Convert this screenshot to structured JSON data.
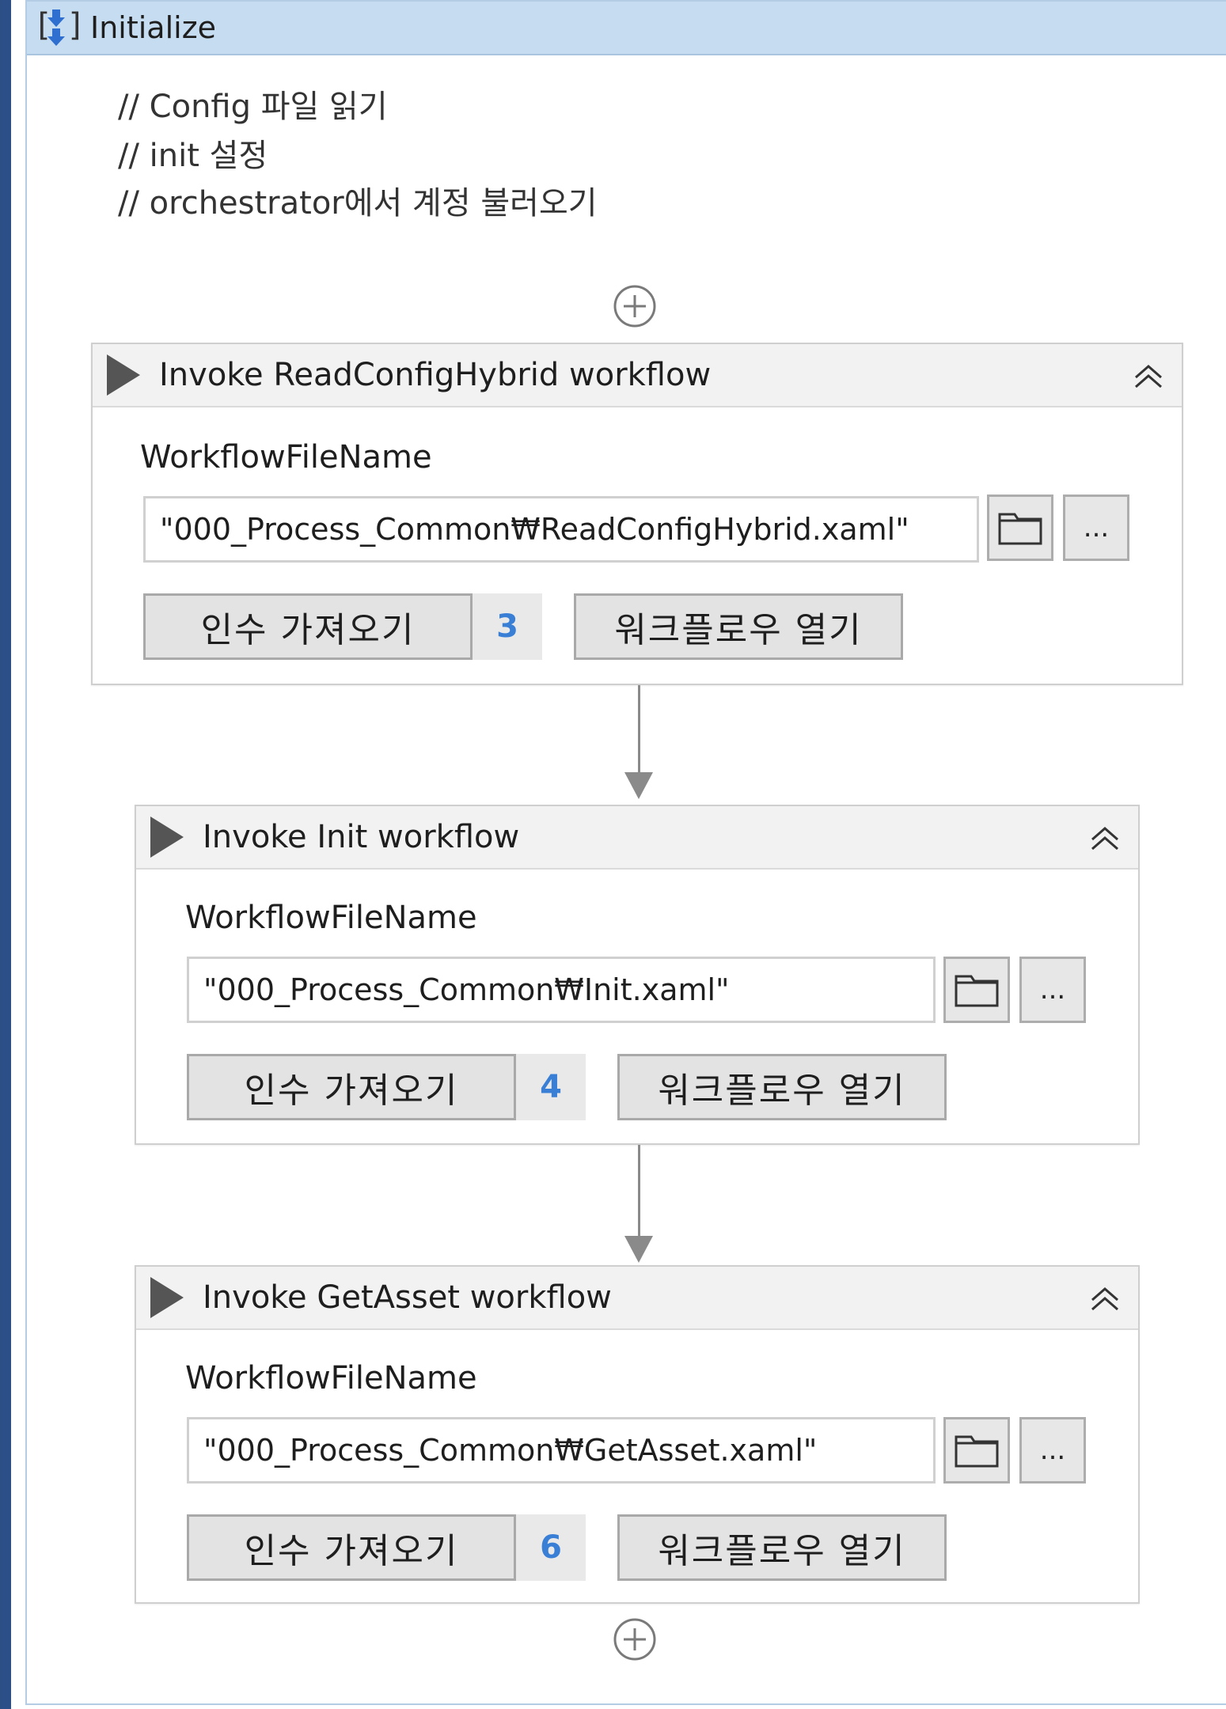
{
  "sequence": {
    "title": "Initialize",
    "comments": [
      "// Config 파일 읽기",
      "// init 설정",
      "// orchestrator에서 계정 불러오기"
    ]
  },
  "activities": [
    {
      "title": "Invoke ReadConfigHybrid workflow",
      "field_label": "WorkflowFileName",
      "file_path": "\"000_Process_Common₩ReadConfigHybrid.xaml\"",
      "import_args_label": "인수 가져오기",
      "arg_count": "3",
      "open_workflow_label": "워크플로우 열기",
      "more_label": "..."
    },
    {
      "title": "Invoke Init workflow",
      "field_label": "WorkflowFileName",
      "file_path": "\"000_Process_Common₩Init.xaml\"",
      "import_args_label": "인수 가져오기",
      "arg_count": "4",
      "open_workflow_label": "워크플로우 열기",
      "more_label": "..."
    },
    {
      "title": "Invoke GetAsset workflow",
      "field_label": "WorkflowFileName",
      "file_path": "\"000_Process_Common₩GetAsset.xaml\"",
      "import_args_label": "인수 가져오기",
      "arg_count": "6",
      "open_workflow_label": "워크플로우 열기",
      "more_label": "..."
    }
  ],
  "icons": {
    "sequence": "sequence-icon",
    "run": "play-icon",
    "collapse": "double-chevron-up-icon",
    "folder": "folder-icon",
    "add": "add-circle-icon"
  },
  "colors": {
    "header_bg": "#c6dcf0",
    "left_bar": "#2b4f86",
    "arg_count": "#3a7fd6"
  }
}
